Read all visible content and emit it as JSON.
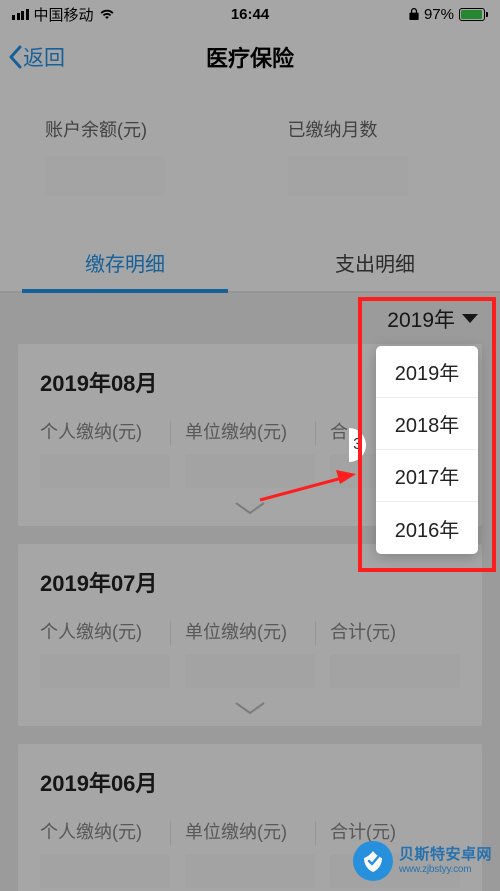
{
  "status": {
    "carrier": "中国移动",
    "time": "16:44",
    "battery": "97%"
  },
  "nav": {
    "back": "返回",
    "title": "医疗保险"
  },
  "summary": {
    "balance_label": "账户余额(元)",
    "months_label": "已缴纳月数"
  },
  "tabs": {
    "deposit": "缴存明细",
    "expense": "支出明细"
  },
  "year_selector": {
    "current": "2019年",
    "options": [
      "2019年",
      "2018年",
      "2017年",
      "2016年"
    ]
  },
  "records": [
    {
      "month": "2019年08月",
      "cols": {
        "personal": "个人缴纳(元)",
        "unit": "单位缴纳(元)",
        "total": "合"
      }
    },
    {
      "month": "2019年07月",
      "cols": {
        "personal": "个人缴纳(元)",
        "unit": "单位缴纳(元)",
        "total": "合计(元)"
      }
    },
    {
      "month": "2019年06月",
      "cols": {
        "personal": "个人缴纳(元)",
        "unit": "单位缴纳(元)",
        "total": "合计(元)"
      }
    }
  ],
  "watermark": {
    "line1": "贝斯特安卓网",
    "line2": "www.zjbstyy.com"
  },
  "peek_char": "3"
}
